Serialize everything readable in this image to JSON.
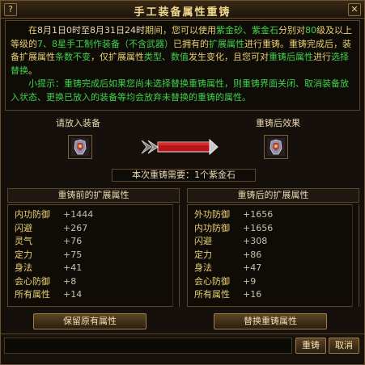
{
  "window": {
    "title": "手工装备属性重铸",
    "help_glyph": "?",
    "close_glyph": "✕"
  },
  "info": {
    "p1": [
      {
        "t": "在",
        "c": "y"
      },
      {
        "t": "8月1日0时至8月31日24时",
        "c": "w"
      },
      {
        "t": "期间，您可以使用",
        "c": "y"
      },
      {
        "t": "紫金砂、紫金石",
        "c": "g"
      },
      {
        "t": "分别对",
        "c": "y"
      },
      {
        "t": "80",
        "c": "g"
      },
      {
        "t": "级及以上等级的",
        "c": "y"
      },
      {
        "t": "7、8",
        "c": "g"
      },
      {
        "t": "星手工制作装备（不含武器）",
        "c": "g"
      },
      {
        "t": "已拥有的",
        "c": "y"
      },
      {
        "t": "扩展属性",
        "c": "g"
      },
      {
        "t": "进行重铸。重铸完成后，装备扩展属性",
        "c": "y"
      },
      {
        "t": "条数不变",
        "c": "g"
      },
      {
        "t": "，仅扩展属性",
        "c": "y"
      },
      {
        "t": "类型、数值",
        "c": "g"
      },
      {
        "t": "发生变化，且您可对",
        "c": "y"
      },
      {
        "t": "重铸后属性",
        "c": "g"
      },
      {
        "t": "进行",
        "c": "y"
      },
      {
        "t": "选择替换",
        "c": "g"
      },
      {
        "t": "。",
        "c": "y"
      }
    ],
    "p2": "小提示：重铸完成后如果您尚未选择替换重铸属性，则重铸界面关闭、取消装备放入状态、更换已放入的装备等均会放弃未替换的重铸的属性。"
  },
  "slots": {
    "left_label": "请放入装备",
    "right_label": "重铸后效果",
    "left_item_icon": "armor-glove-icon",
    "right_item_icon": "armor-glove-icon"
  },
  "cost": {
    "label": "本次重铸需要：1个紫金石"
  },
  "before": {
    "header": "重铸前的扩展属性",
    "rows": [
      {
        "name": "内功防御",
        "value": "+1444"
      },
      {
        "name": "闪避",
        "value": "+267"
      },
      {
        "name": "灵气",
        "value": "+76"
      },
      {
        "name": "定力",
        "value": "+75"
      },
      {
        "name": "身法",
        "value": "+41"
      },
      {
        "name": "会心防御",
        "value": "+8"
      },
      {
        "name": "所有属性",
        "value": "+14"
      }
    ],
    "button": "保留原有属性"
  },
  "after": {
    "header": "重铸后的扩展属性",
    "rows": [
      {
        "name": "外功防御",
        "value": "+1656"
      },
      {
        "name": "内功防御",
        "value": "+1656"
      },
      {
        "name": "闪避",
        "value": "+308"
      },
      {
        "name": "定力",
        "value": "+86"
      },
      {
        "name": "身法",
        "value": "+47"
      },
      {
        "name": "会心防御",
        "value": "+9"
      },
      {
        "name": "所有属性",
        "value": "+16"
      }
    ],
    "button": "替换重铸属性"
  },
  "bottom": {
    "recast_button": "重铸",
    "cancel_button": "取消"
  },
  "colors": {
    "accent_yellow": "#e8d070",
    "accent_green": "#3fd24a",
    "frame_gold": "#a07e45"
  }
}
